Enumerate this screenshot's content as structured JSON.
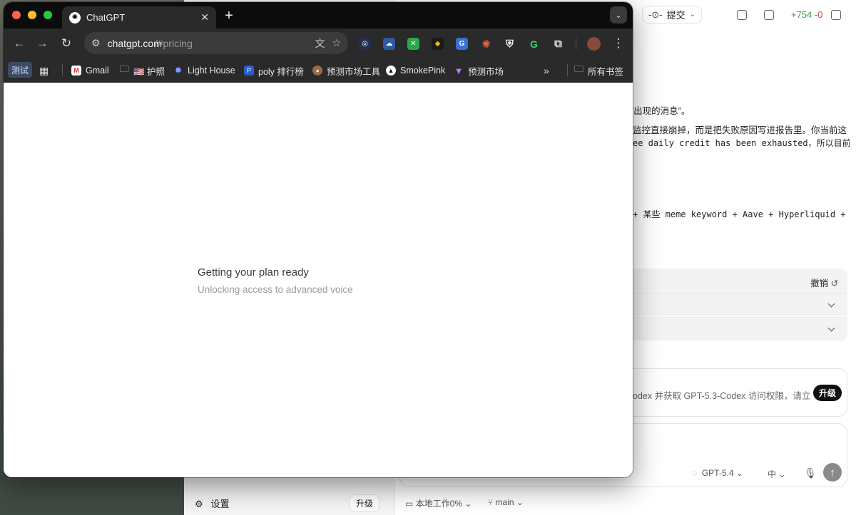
{
  "background_app": {
    "commit_button": "提交",
    "diff_stats": {
      "added": "+754",
      "removed": "-0"
    },
    "messages": [
      "“出现的消息”。",
      "监控直接崩掉，而是把失败原因写进报告里。你当前这",
      "ee daily credit has been exhausted，所以目前",
      "+ 某些 meme keyword + Aave + Hyperliquid +"
    ],
    "undo_label": "撤销",
    "upgrade_card_text": "odex 并获取 GPT-5.3-Codex 访问权限，请立",
    "upgrade_button": "升级",
    "composer": {
      "model": "GPT-5.4",
      "reasoning": "中"
    },
    "sidebar_footer": {
      "settings_label": "设置",
      "upgrade_label": "升级"
    },
    "status_bar": {
      "local_work": "本地工作0%",
      "branch": "main"
    }
  },
  "browser": {
    "tab_title": "ChatGPT",
    "url_host": "chatgpt.com",
    "url_path": "/#pricing",
    "bookmarks": [
      {
        "label": "测试",
        "icon": "folder-icon"
      },
      {
        "label": "Gmail",
        "icon": "gmail-icon"
      },
      {
        "label": "🇺🇸 护照",
        "icon": "folder-icon"
      },
      {
        "label": "Light House",
        "icon": "lighthouse-icon"
      },
      {
        "label": "poly 排行榜",
        "icon": "poly-icon"
      },
      {
        "label": "预测市场工具",
        "icon": "monkey-icon"
      },
      {
        "label": "SmokePink",
        "icon": "triangle-icon"
      },
      {
        "label": "预测市场",
        "icon": "v-icon"
      },
      {
        "label": "所有书签",
        "icon": "folder-icon"
      }
    ]
  },
  "page": {
    "status_title": "Getting your plan ready",
    "status_subtitle": "Unlocking access to advanced voice"
  },
  "colors": {
    "tab_strip": "#0c0c0c",
    "toolbar": "#2a2a2a",
    "close": "#ff5f57",
    "minimize": "#febc2e",
    "zoom": "#28c840",
    "diff_added": "#3aa14a",
    "diff_removed": "#d1453b"
  }
}
